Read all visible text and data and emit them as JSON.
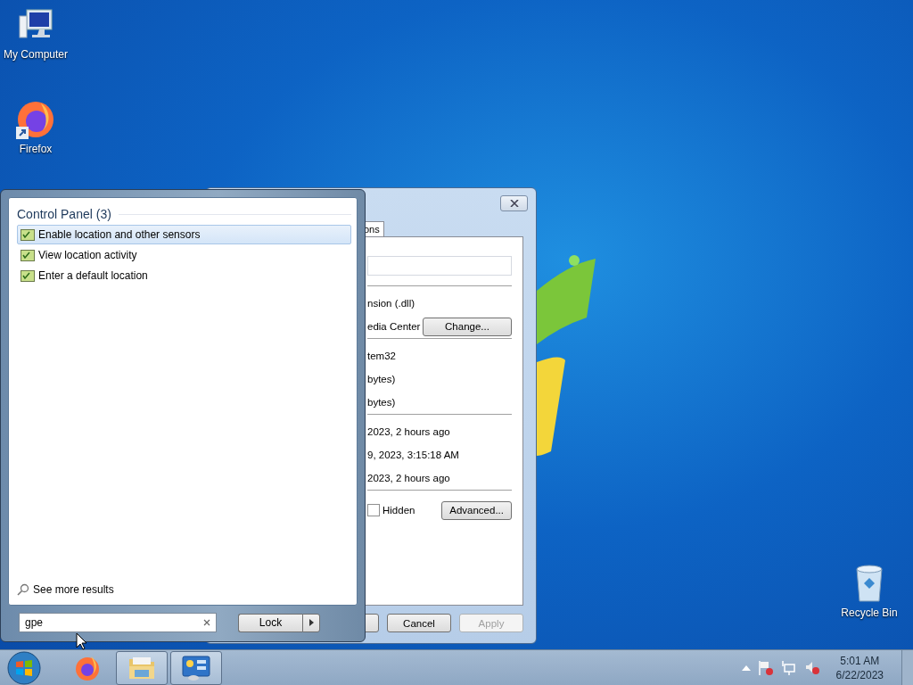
{
  "desktop_icons": [
    {
      "kind": "computer",
      "label": "My Computer"
    },
    {
      "kind": "firefox",
      "label": "Firefox"
    },
    {
      "kind": "recycle",
      "label": "Recycle Bin"
    }
  ],
  "dialog": {
    "tab": {
      "label": "ons",
      "selected": true
    },
    "rows": [
      {
        "kind": "text",
        "text": "nsion (.dll)"
      },
      {
        "kind": "button",
        "text": "edia Center",
        "button": "Change..."
      },
      {
        "kind": "separator"
      },
      {
        "kind": "text",
        "text": "tem32"
      },
      {
        "kind": "text",
        "text": "bytes)"
      },
      {
        "kind": "text",
        "text": "bytes)"
      },
      {
        "kind": "separator"
      },
      {
        "kind": "text",
        "text": "2023, 2 hours ago"
      },
      {
        "kind": "text",
        "text": "9, 2023, 3:15:18 AM"
      },
      {
        "kind": "text",
        "text": "2023, 2 hours ago"
      },
      {
        "kind": "separator"
      },
      {
        "kind": "check",
        "text": "Hidden",
        "checked": false,
        "button": "Advanced..."
      }
    ],
    "buttons": [
      {
        "label": "Cancel",
        "disabled": false
      },
      {
        "label": "Apply",
        "disabled": true
      }
    ]
  },
  "start_menu": {
    "group_title": "Control Panel (3)",
    "results": [
      {
        "label": "Enable location and other sensors",
        "selected": true
      },
      {
        "label": "View location activity",
        "selected": false
      },
      {
        "label": "Enter a default location",
        "selected": false
      }
    ],
    "see_more": "See more results",
    "search": {
      "value": "gpe"
    },
    "power_button": {
      "label": "Lock"
    }
  },
  "taskbar": {
    "items": [
      {
        "kind": "firefox",
        "active": false
      },
      {
        "kind": "explorer",
        "active": true
      },
      {
        "kind": "control",
        "active": true
      }
    ],
    "clock": {
      "time": "5:01 AM",
      "date": "6/22/2023"
    }
  }
}
